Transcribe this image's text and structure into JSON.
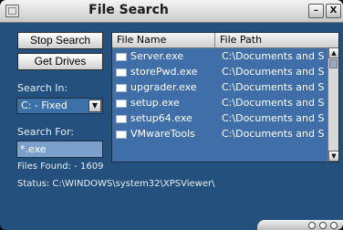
{
  "window": {
    "title": "File Search",
    "minimize_glyph": "–",
    "close_glyph": "X"
  },
  "buttons": {
    "stop_search": "Stop Search",
    "get_drives": "Get Drives"
  },
  "search_in": {
    "label": "Search In:",
    "selected": "C: - Fixed",
    "dropdown_glyph": "▼"
  },
  "search_for": {
    "label": "Search For:",
    "value": "*.exe"
  },
  "results": {
    "files_found": "Files Found: - 1609",
    "status": "Status: C:\\WINDOWS\\system32\\XPSViewer\\"
  },
  "file_list": {
    "columns": [
      "File Name",
      "File Path"
    ],
    "rows": [
      {
        "name": "Server.exe",
        "path": "C:\\Documents and S"
      },
      {
        "name": "storePwd.exe",
        "path": "C:\\Documents and S"
      },
      {
        "name": "upgrader.exe",
        "path": "C:\\Documents and S"
      },
      {
        "name": "setup.exe",
        "path": "C:\\Documents and S"
      },
      {
        "name": "setup64.exe",
        "path": "C:\\Documents and S"
      },
      {
        "name": "VMwareTools",
        "path": "C:\\Documents and S"
      }
    ],
    "scroll_up_glyph": "▲",
    "scroll_down_glyph": "▼"
  },
  "colors": {
    "window_bg": "#24507e",
    "list_bg": "#3f6ea8",
    "input_bg": "#7ca0cc"
  }
}
